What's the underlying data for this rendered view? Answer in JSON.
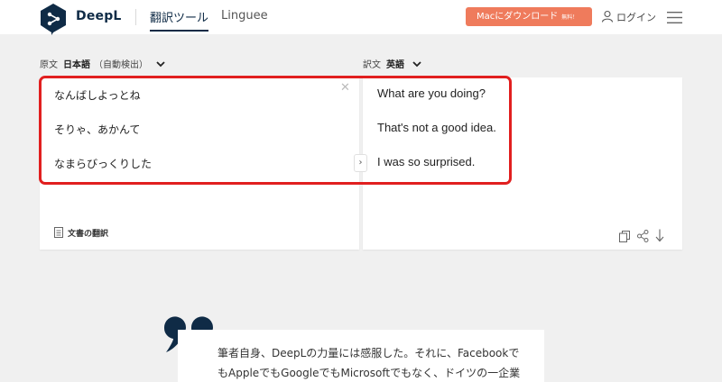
{
  "header": {
    "brand": "DeepL",
    "nav_translator": "翻訳ツール",
    "nav_linguee": "Linguee",
    "mac_download": "Macにダウンロード",
    "mac_free": "無料！",
    "login": "ログイン"
  },
  "source": {
    "label": "原文",
    "language": "日本語",
    "auto": "（自動検出）",
    "lines": [
      "なんばしよっとね",
      "そりゃ、あかんて",
      "なまらびっくりした"
    ],
    "doc_translate": "文書の翻訳"
  },
  "target": {
    "label": "訳文",
    "language": "英語",
    "lines": [
      "What are you doing?",
      "That's not a good idea.",
      "I was so surprised."
    ]
  },
  "quote": {
    "lines": [
      "筆者自身、DeepLの力量には感服した。それに、Facebookで",
      "もAppleでもGoogleでもMicrosoftでもなく、ドイツの一企業"
    ]
  },
  "colors": {
    "brand_navy": "#0f2b46",
    "cta_orange": "#ef7b5c",
    "highlight_red": "#e11f1f"
  },
  "icons": [
    "deepl-logo-icon",
    "user-icon",
    "hamburger-menu-icon",
    "chevron-down-icon",
    "close-icon",
    "document-icon",
    "arrow-right-icon",
    "copy-icon",
    "share-icon",
    "download-icon",
    "quote-mark-icon"
  ]
}
